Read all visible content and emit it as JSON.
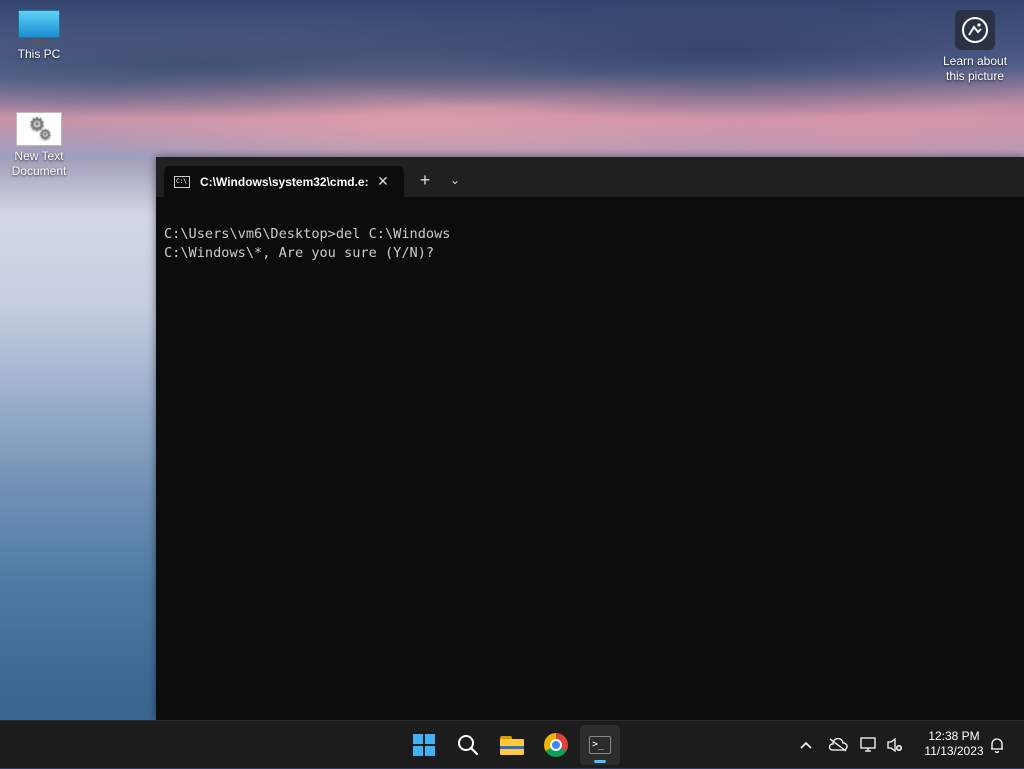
{
  "desktop": {
    "icons": [
      {
        "label": "This PC",
        "icon": "monitor-icon"
      },
      {
        "label": "New Text Document",
        "icon": "gear-document-icon"
      }
    ],
    "learn_about": {
      "label": "Learn about this picture",
      "icon": "spotlight-camera-icon"
    }
  },
  "terminal": {
    "tab_title": "C:\\Windows\\system32\\cmd.e:",
    "tab_close": "✕",
    "new_tab": "+",
    "dropdown": "⌄",
    "lines": [
      "C:\\Users\\vm6\\Desktop>del C:\\Windows",
      "C:\\Windows\\*, Are you sure (Y/N)?"
    ]
  },
  "taskbar": {
    "apps": [
      {
        "name": "Start",
        "icon": "windows-start-icon"
      },
      {
        "name": "Search",
        "icon": "search-icon"
      },
      {
        "name": "File Explorer",
        "icon": "folder-icon"
      },
      {
        "name": "Google Chrome",
        "icon": "chrome-icon"
      },
      {
        "name": "Terminal",
        "icon": "terminal-icon",
        "active": true
      }
    ],
    "tray": {
      "chevron": "^",
      "time": "12:38 PM",
      "date": "11/13/2023"
    }
  },
  "colors": {
    "accent": "#4cc2ff",
    "terminal_bg": "#0c0c0c",
    "taskbar_bg": "#1c1c1c"
  }
}
